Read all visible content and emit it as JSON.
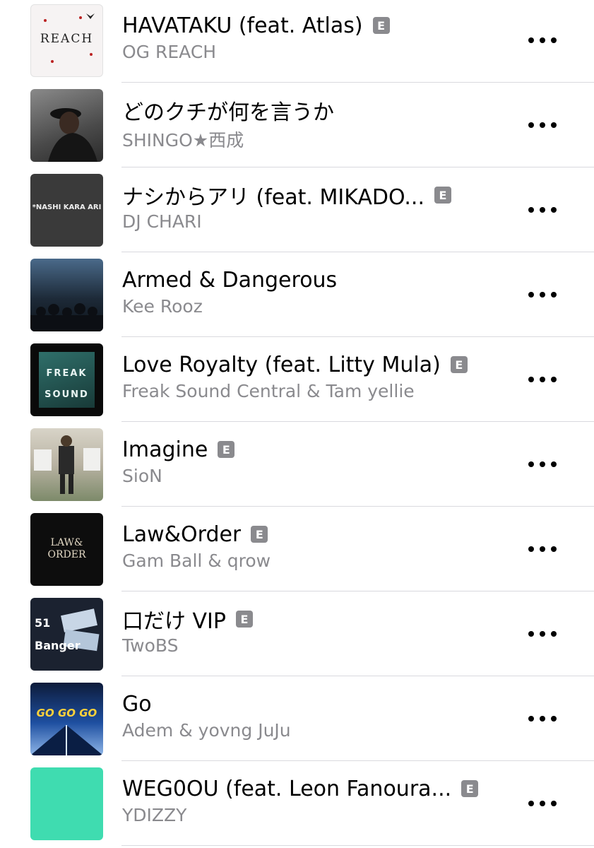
{
  "tracks": [
    {
      "title": "HAVATAKU (feat. Atlas)",
      "artist": "OG REACH",
      "explicit": true,
      "explicit_label": "E",
      "art_text": "REACH",
      "art_bg": "#f6f3f3"
    },
    {
      "title": "どのクチが何を言うか",
      "artist": "SHINGO★西成",
      "explicit": false,
      "explicit_label": "",
      "art_text": "",
      "art_bg": "#6b6b6b"
    },
    {
      "title": "ナシからアリ (feat. MIKADO...",
      "artist": "DJ CHARI",
      "explicit": true,
      "explicit_label": "E",
      "art_text": "*NASHI KARA ARI",
      "art_bg": "#3a3a3a"
    },
    {
      "title": "Armed & Dangerous",
      "artist": "Kee Rooz",
      "explicit": false,
      "explicit_label": "",
      "art_text": "",
      "art_bg": "#2b3e52"
    },
    {
      "title": "Love Royalty (feat. Litty Mula)",
      "artist": "Freak Sound Central & Tam yellie",
      "explicit": true,
      "explicit_label": "E",
      "art_text": "FREAK SOUND",
      "art_bg": "#1d3e3a"
    },
    {
      "title": "Imagine",
      "artist": "SioN",
      "explicit": true,
      "explicit_label": "E",
      "art_text": "",
      "art_bg": "#bdb6a6"
    },
    {
      "title": "Law&Order",
      "artist": "Gam Ball & qrow",
      "explicit": true,
      "explicit_label": "E",
      "art_text": "LAW& ORDER",
      "art_bg": "#0d0d0d"
    },
    {
      "title": "口だけ VIP",
      "artist": "TwoBS",
      "explicit": true,
      "explicit_label": "E",
      "art_text": "51 Banger",
      "art_bg": "#1b2230"
    },
    {
      "title": "Go",
      "artist": "Adem & yovng JuJu",
      "explicit": false,
      "explicit_label": "",
      "art_text": "GO GO GO",
      "art_bg": "#1e4fa0"
    },
    {
      "title": "WEG0OU (feat. Leon Fanoura...",
      "artist": "YDIZZY",
      "explicit": true,
      "explicit_label": "E",
      "art_text": "",
      "art_bg": "#3fdcb0"
    }
  ]
}
